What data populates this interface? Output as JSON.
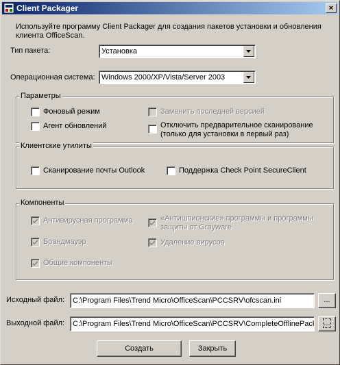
{
  "window": {
    "title": "Client Packager",
    "close_glyph": "×"
  },
  "intro": {
    "line1": "Используйте программу Client Packager для создания пакетов установки и обновления",
    "line2": "клиента OfficeScan."
  },
  "package_type": {
    "label": "Тип пакета:",
    "value": "Установка"
  },
  "os": {
    "label": "Операционная система:",
    "value": "Windows 2000/XP/Vista/Server 2003"
  },
  "params": {
    "legend": "Параметры",
    "background": "Фоновый режим",
    "update_agent": "Агент обновлений",
    "replace_latest": "Заменить последней версией",
    "disable_prescan_1": "Отключить предварительное сканирование",
    "disable_prescan_2": "(только для установки в первый раз)"
  },
  "utils": {
    "legend": "Клиентские утилиты",
    "outlook": "Сканирование почты Outlook",
    "checkpoint": "Поддержка Check Point SecureClient"
  },
  "components": {
    "legend": "Компоненты",
    "antivirus": "Антивирусная программа",
    "antispyware_1": "«Антишпионские» программы и программы",
    "antispyware_2": "защиты от Grayware",
    "firewall": "Брандмауэр",
    "virus_removal": "Удаление вирусов",
    "common": "Общие компоненты"
  },
  "source": {
    "label": "Исходный файл:",
    "value": "C:\\Program Files\\Trend Micro\\OfficeScan\\PCCSRV\\ofcscan.ini",
    "browse": "..."
  },
  "output": {
    "label": "Выходной файл:",
    "value": "C:\\Program Files\\Trend Micro\\OfficeScan\\PCCSRV\\CompleteOfflinePack",
    "browse": "..."
  },
  "buttons": {
    "create": "Создать",
    "close": "Закрыть"
  }
}
